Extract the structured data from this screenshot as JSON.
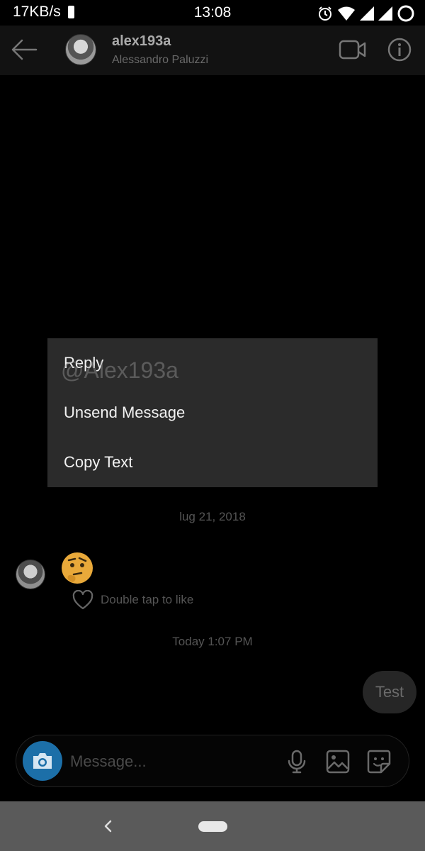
{
  "status_bar": {
    "network_speed": "17KB/s",
    "time": "13:08",
    "icons": [
      "battery-saver-icon",
      "alarm-icon",
      "wifi-icon",
      "signal-icon",
      "signal-icon",
      "oneplus-ring-icon"
    ]
  },
  "header": {
    "username": "alex193a",
    "full_name": "Alessandro Paluzzi",
    "back_icon": "arrow-left-icon",
    "video_icon": "video-call-icon",
    "info_icon": "info-icon"
  },
  "context_menu": {
    "items": [
      {
        "label": "Reply"
      },
      {
        "label": "Unsend Message"
      },
      {
        "label": "Copy Text"
      }
    ],
    "watermark": "@Alex193a"
  },
  "chat": {
    "date_separator_1": "lug 21, 2018",
    "received_message_emoji": "thinking-face-emoji",
    "like_hint": "Double tap to like",
    "date_separator_2": "Today 1:07 PM",
    "sent_message": "Test"
  },
  "composer": {
    "placeholder": "Message...",
    "icons": [
      "camera-icon",
      "microphone-icon",
      "gallery-icon",
      "sticker-icon"
    ]
  },
  "colors": {
    "camera_button": "#1c6fa8",
    "menu_background": "#2b2b2b",
    "header_background": "#121212",
    "nav_bar": "#5a5a5a"
  }
}
